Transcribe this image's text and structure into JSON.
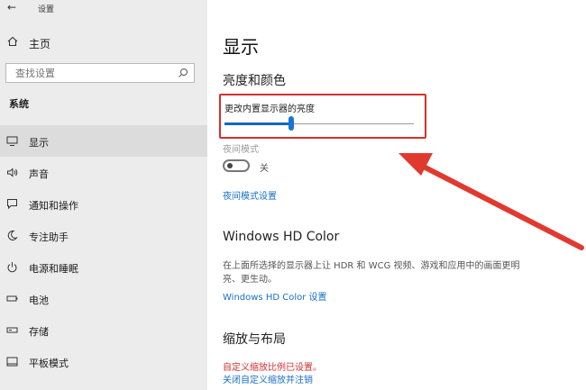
{
  "window": {
    "back_glyph": "←",
    "title": "设置"
  },
  "sidebar": {
    "home_label": "主页",
    "search_placeholder": "查找设置",
    "section_label": "系统",
    "items": [
      {
        "label": "显示",
        "icon": "monitor-icon",
        "active": true
      },
      {
        "label": "声音",
        "icon": "speaker-icon"
      },
      {
        "label": "通知和操作",
        "icon": "notification-icon"
      },
      {
        "label": "专注助手",
        "icon": "moon-icon"
      },
      {
        "label": "电源和睡眠",
        "icon": "power-icon"
      },
      {
        "label": "电池",
        "icon": "battery-icon"
      },
      {
        "label": "存储",
        "icon": "storage-icon"
      },
      {
        "label": "平板模式",
        "icon": "tablet-icon"
      }
    ]
  },
  "main": {
    "title": "显示",
    "brightness_section": "亮度和颜色",
    "brightness_label": "更改内置显示器的亮度",
    "brightness_value": 0.35,
    "night_light_label": "夜间模式",
    "night_light_state": "关",
    "night_light_link": "夜间模式设置",
    "hd_color_heading": "Windows HD Color",
    "hd_color_desc": "在上面所选择的显示器上让 HDR 和 WCG 视频、游戏和应用中的画面更明亮、更生动。",
    "hd_color_link": "Windows HD Color 设置",
    "zoom_heading": "缩放与布局",
    "zoom_warning": "自定义缩放比例已设置。",
    "zoom_revert_link": "关闭自定义缩放并注销"
  },
  "colors": {
    "accent": "#1976d2",
    "link": "#1a6fc4",
    "highlight_box": "#d6302c",
    "annotation_arrow": "#e03a30",
    "warning": "#d32f2f",
    "sidebar_bg": "#ececec"
  }
}
